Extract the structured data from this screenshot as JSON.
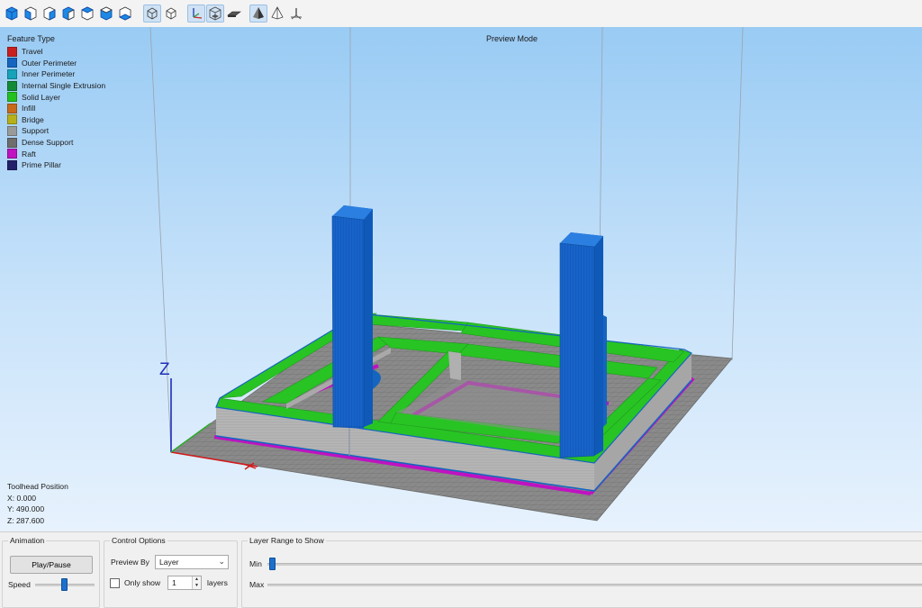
{
  "toolbar": {
    "view_buttons": [
      {
        "icon": "view-iso-front-icon",
        "active": false
      },
      {
        "icon": "view-front-icon",
        "active": false
      },
      {
        "icon": "view-back-icon",
        "active": false
      },
      {
        "icon": "view-left-icon",
        "active": false
      },
      {
        "icon": "view-right-icon",
        "active": false
      },
      {
        "icon": "view-top-icon",
        "active": false
      },
      {
        "icon": "view-bottom-icon",
        "active": false
      }
    ],
    "projection_buttons": [
      {
        "icon": "orthographic-icon",
        "active": true
      },
      {
        "icon": "perspective-icon",
        "active": false
      }
    ],
    "display_buttons": [
      {
        "icon": "axes-toggle-icon",
        "active": true
      },
      {
        "icon": "build-volume-toggle-icon",
        "active": true
      },
      {
        "icon": "bed-toggle-icon",
        "active": false
      },
      {
        "icon": "model-shading-icon",
        "active": true
      },
      {
        "icon": "wireframe-icon",
        "active": false
      },
      {
        "icon": "origin-icon",
        "active": false
      }
    ]
  },
  "viewport": {
    "mode_label": "Preview Mode",
    "legend": {
      "title": "Feature Type",
      "items": [
        {
          "label": "Travel",
          "color": "#c8201e"
        },
        {
          "label": "Outer Perimeter",
          "color": "#1565c0"
        },
        {
          "label": "Inner Perimeter",
          "color": "#17a2b8"
        },
        {
          "label": "Internal Single Extrusion",
          "color": "#138a36"
        },
        {
          "label": "Solid Layer",
          "color": "#24c020"
        },
        {
          "label": "Infill",
          "color": "#c86a1a"
        },
        {
          "label": "Bridge",
          "color": "#b8b01a"
        },
        {
          "label": "Support",
          "color": "#9a9a9a"
        },
        {
          "label": "Dense Support",
          "color": "#6e6e6e"
        },
        {
          "label": "Raft",
          "color": "#c012c0"
        },
        {
          "label": "Prime Pillar",
          "color": "#24206a"
        }
      ]
    },
    "axis_label": "Z",
    "toolhead": {
      "title": "Toolhead Position",
      "x": "X: 0.000",
      "y": "Y: 490.000",
      "z": "Z: 287.600"
    }
  },
  "animation": {
    "title": "Animation",
    "play_label": "Play/Pause",
    "speed_label": "Speed",
    "speed_value": 0.5
  },
  "control_options": {
    "title": "Control Options",
    "preview_by_label": "Preview By",
    "preview_by_value": "Layer",
    "only_show_label": "Only show",
    "only_show_checked": false,
    "layers_value": "1",
    "layers_label": "layers"
  },
  "layer_range": {
    "title": "Layer Range to Show",
    "min_label": "Min",
    "max_label": "Max",
    "min_value": 0.0
  }
}
